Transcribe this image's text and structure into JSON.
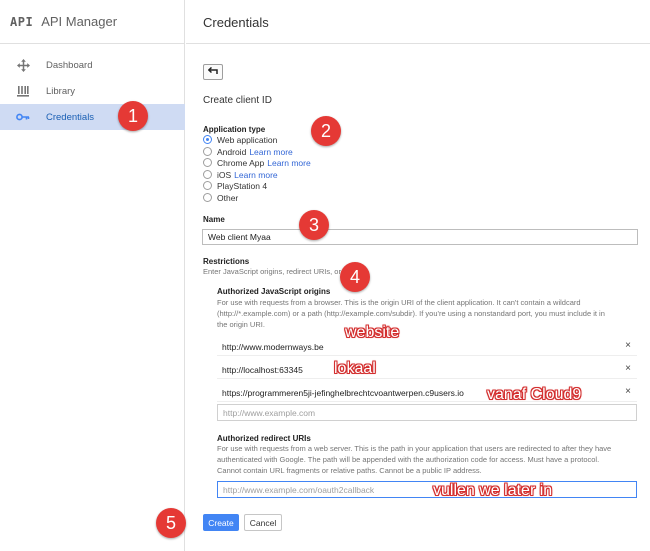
{
  "sidebar": {
    "logo": "API",
    "title": "API Manager",
    "items": [
      {
        "label": "Dashboard",
        "icon": "dashboard-icon"
      },
      {
        "label": "Library",
        "icon": "library-icon"
      },
      {
        "label": "Credentials",
        "icon": "key-icon",
        "active": true
      }
    ]
  },
  "header": {
    "title": "Credentials"
  },
  "form": {
    "heading": "Create client ID",
    "application_type": {
      "label": "Application type",
      "options": [
        {
          "label": "Web application",
          "link": "",
          "checked": true
        },
        {
          "label": "Android",
          "link": "Learn more",
          "checked": false
        },
        {
          "label": "Chrome App",
          "link": "Learn more",
          "checked": false
        },
        {
          "label": "iOS",
          "link": "Learn more",
          "checked": false
        },
        {
          "label": "PlayStation 4",
          "link": "",
          "checked": false
        },
        {
          "label": "Other",
          "link": "",
          "checked": false
        }
      ]
    },
    "name": {
      "label": "Name",
      "value": "Web client Myaa"
    },
    "restrictions": {
      "label": "Restrictions",
      "description": "Enter JavaScript origins, redirect URIs, or both",
      "js_origins": {
        "label": "Authorized JavaScript origins",
        "help_line1": "For use with requests from a browser. This is the origin URI of the client application. It can't contain a wildcard",
        "help_line2": "(http://*.example.com) or a path (http://example.com/subdir). If you're using a nonstandard port, you must include it in",
        "help_line3": "the origin URI.",
        "entries": [
          "http://www.modernways.be",
          "http://localhost:63345",
          "https://programmeren5ji-jefinghelbrechtcvoantwerpen.c9users.io"
        ],
        "remove_symbol": "×",
        "placeholder": "http://www.example.com"
      },
      "redirect_uris": {
        "label": "Authorized redirect URIs",
        "help_line1": "For use with requests from a web server. This is the path in your application that users are redirected to after they have",
        "help_line2": "authenticated with Google. The path will be appended with the authorization code for access. Must have a protocol.",
        "help_line3": "Cannot contain URL fragments or relative paths. Cannot be a public IP address.",
        "placeholder": "http://www.example.com/oauth2callback"
      }
    },
    "buttons": {
      "create": "Create",
      "cancel": "Cancel"
    }
  },
  "annotations": {
    "badges": [
      "1",
      "2",
      "3",
      "4",
      "5"
    ],
    "notes": [
      "website",
      "lokaal",
      "vanaf Cloud9",
      "vullen we later in"
    ],
    "badge_color": "#e53935"
  },
  "colors": {
    "accent": "#4285f4",
    "link": "#3367d6",
    "active_bg": "#cfdbf3"
  }
}
